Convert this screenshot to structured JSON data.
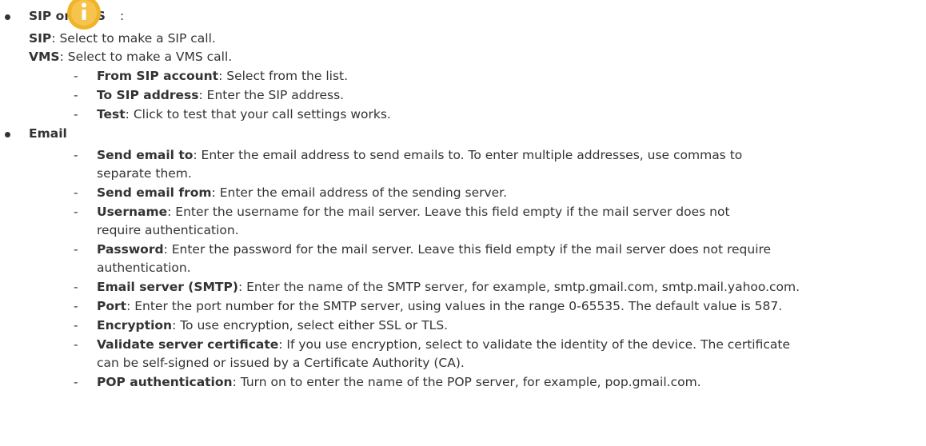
{
  "sip_vms": {
    "title": "SIP or VMS",
    "colon": ":",
    "sip_label": "SIP",
    "sip_text": ": Select to make a SIP call.",
    "vms_label": "VMS",
    "vms_text": ": Select to make a VMS call.",
    "items": [
      {
        "label": "From SIP account",
        "text": ": Select from the list."
      },
      {
        "label": "To SIP address",
        "text": ": Enter the SIP address."
      },
      {
        "label": "Test",
        "text": ": Click to test that your call settings works."
      }
    ]
  },
  "email": {
    "title": "Email",
    "items": [
      {
        "label": "Send email to",
        "text": ": Enter the email address to send emails to. To enter multiple addresses, use commas to",
        "text2": "separate them."
      },
      {
        "label": "Send email from",
        "text": ": Enter the email address of the sending server."
      },
      {
        "label": "Username",
        "text": ": Enter the username for the mail server. Leave this field empty if the mail server does not",
        "text2": "require authentication."
      },
      {
        "label": "Password",
        "text": ": Enter the password for the mail server. Leave this field empty if the mail server does not require",
        "text2": "authentication."
      },
      {
        "label": "Email server (SMTP)",
        "text": ": Enter the name of the SMTP server, for example, smtp.gmail.com, smtp.mail.yahoo.com."
      },
      {
        "label": "Port",
        "text": ": Enter the port number for the SMTP server, using values in the range 0-65535. The default value is 587."
      },
      {
        "label": "Encryption",
        "text": ": To use encryption, select either SSL or TLS."
      },
      {
        "label": "Validate server certificate",
        "text": ": If you use encryption, select to validate the identity of the device. The certificate",
        "text2": "can be self-signed or issued by a Certificate Authority (CA)."
      },
      {
        "label": "POP authentication",
        "text": ": Turn on to enter the name of the POP server, for example, pop.gmail.com."
      }
    ]
  },
  "colors": {
    "text": "#333333",
    "info_icon": "#f0b429"
  },
  "icons": {
    "info": "info-icon"
  }
}
